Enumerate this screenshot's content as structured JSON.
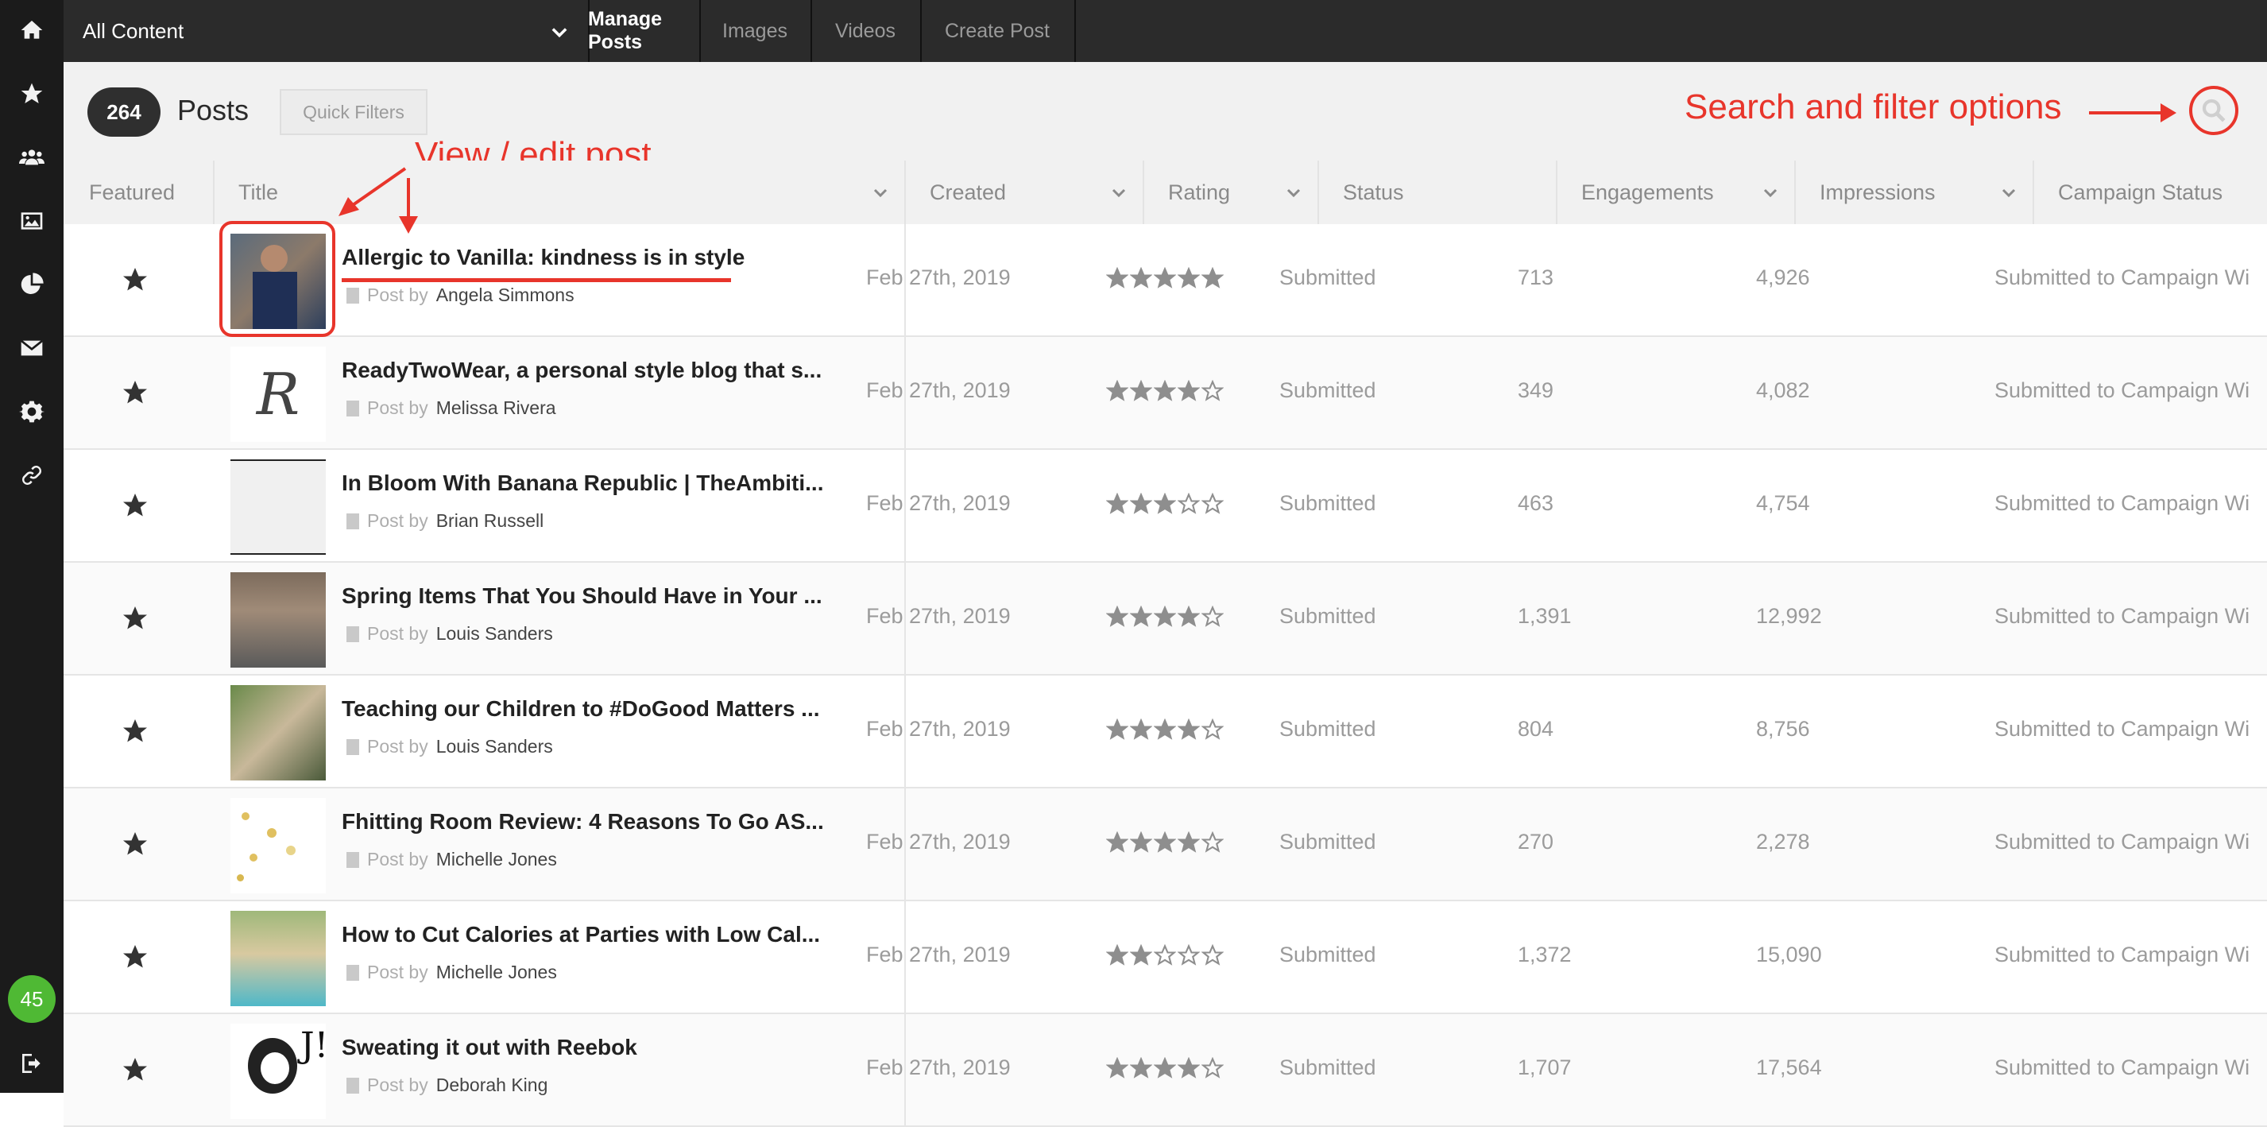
{
  "sidebar": {
    "icons": [
      "home-icon",
      "star-icon",
      "users-icon",
      "image-icon",
      "pie-chart-icon",
      "mail-icon",
      "gear-icon",
      "link-icon"
    ],
    "badge": "45",
    "logout_icon": "logout-icon"
  },
  "topbar": {
    "content_select": "All Content",
    "tabs": [
      {
        "label": "Manage Posts",
        "active": true
      },
      {
        "label": "Images",
        "active": false
      },
      {
        "label": "Videos",
        "active": false
      },
      {
        "label": "Create Post",
        "active": false
      }
    ]
  },
  "header": {
    "count": "264",
    "title": "Posts",
    "quick_filters": "Quick Filters"
  },
  "annotations": {
    "view_edit": "View / edit post",
    "search_filter": "Search and filter options",
    "color": "#e8352b"
  },
  "columns": [
    "Featured",
    "Title",
    "Created",
    "Rating",
    "Status",
    "Engagements",
    "Impressions",
    "Campaign Status"
  ],
  "post_by_label": "Post by",
  "rows": [
    {
      "title": "Allergic to Vanilla: kindness is in style",
      "author": "Angela Simmons",
      "created": "Feb 27th, 2019",
      "rating": 5,
      "status": "Submitted",
      "engagements": "713",
      "impressions": "4,926",
      "campaign": "Submitted to Campaign Wi"
    },
    {
      "title": "ReadyTwoWear, a personal style blog that s...",
      "author": "Melissa Rivera",
      "created": "Feb 27th, 2019",
      "rating": 4,
      "status": "Submitted",
      "engagements": "349",
      "impressions": "4,082",
      "campaign": "Submitted to Campaign Wi"
    },
    {
      "title": "In Bloom With Banana Republic | TheAmbiti...",
      "author": "Brian Russell",
      "created": "Feb 27th, 2019",
      "rating": 3,
      "status": "Submitted",
      "engagements": "463",
      "impressions": "4,754",
      "campaign": "Submitted to Campaign Wi"
    },
    {
      "title": "Spring Items That You Should Have in Your ...",
      "author": "Louis Sanders",
      "created": "Feb 27th, 2019",
      "rating": 4,
      "status": "Submitted",
      "engagements": "1,391",
      "impressions": "12,992",
      "campaign": "Submitted to Campaign Wi"
    },
    {
      "title": "Teaching our Children to #DoGood Matters ...",
      "author": "Louis Sanders",
      "created": "Feb 27th, 2019",
      "rating": 4,
      "status": "Submitted",
      "engagements": "804",
      "impressions": "8,756",
      "campaign": "Submitted to Campaign Wi"
    },
    {
      "title": "Fhitting Room Review: 4 Reasons To Go AS...",
      "author": "Michelle Jones",
      "created": "Feb 27th, 2019",
      "rating": 4,
      "status": "Submitted",
      "engagements": "270",
      "impressions": "2,278",
      "campaign": "Submitted to Campaign Wi"
    },
    {
      "title": "How to Cut Calories at Parties with Low Cal...",
      "author": "Michelle Jones",
      "created": "Feb 27th, 2019",
      "rating": 2,
      "status": "Submitted",
      "engagements": "1,372",
      "impressions": "15,090",
      "campaign": "Submitted to Campaign Wi"
    },
    {
      "title": "Sweating it out with Reebok",
      "author": "Deborah King",
      "created": "Feb 27th, 2019",
      "rating": 4,
      "status": "Submitted",
      "engagements": "1,707",
      "impressions": "17,564",
      "campaign": "Submitted to Campaign Wi"
    }
  ]
}
